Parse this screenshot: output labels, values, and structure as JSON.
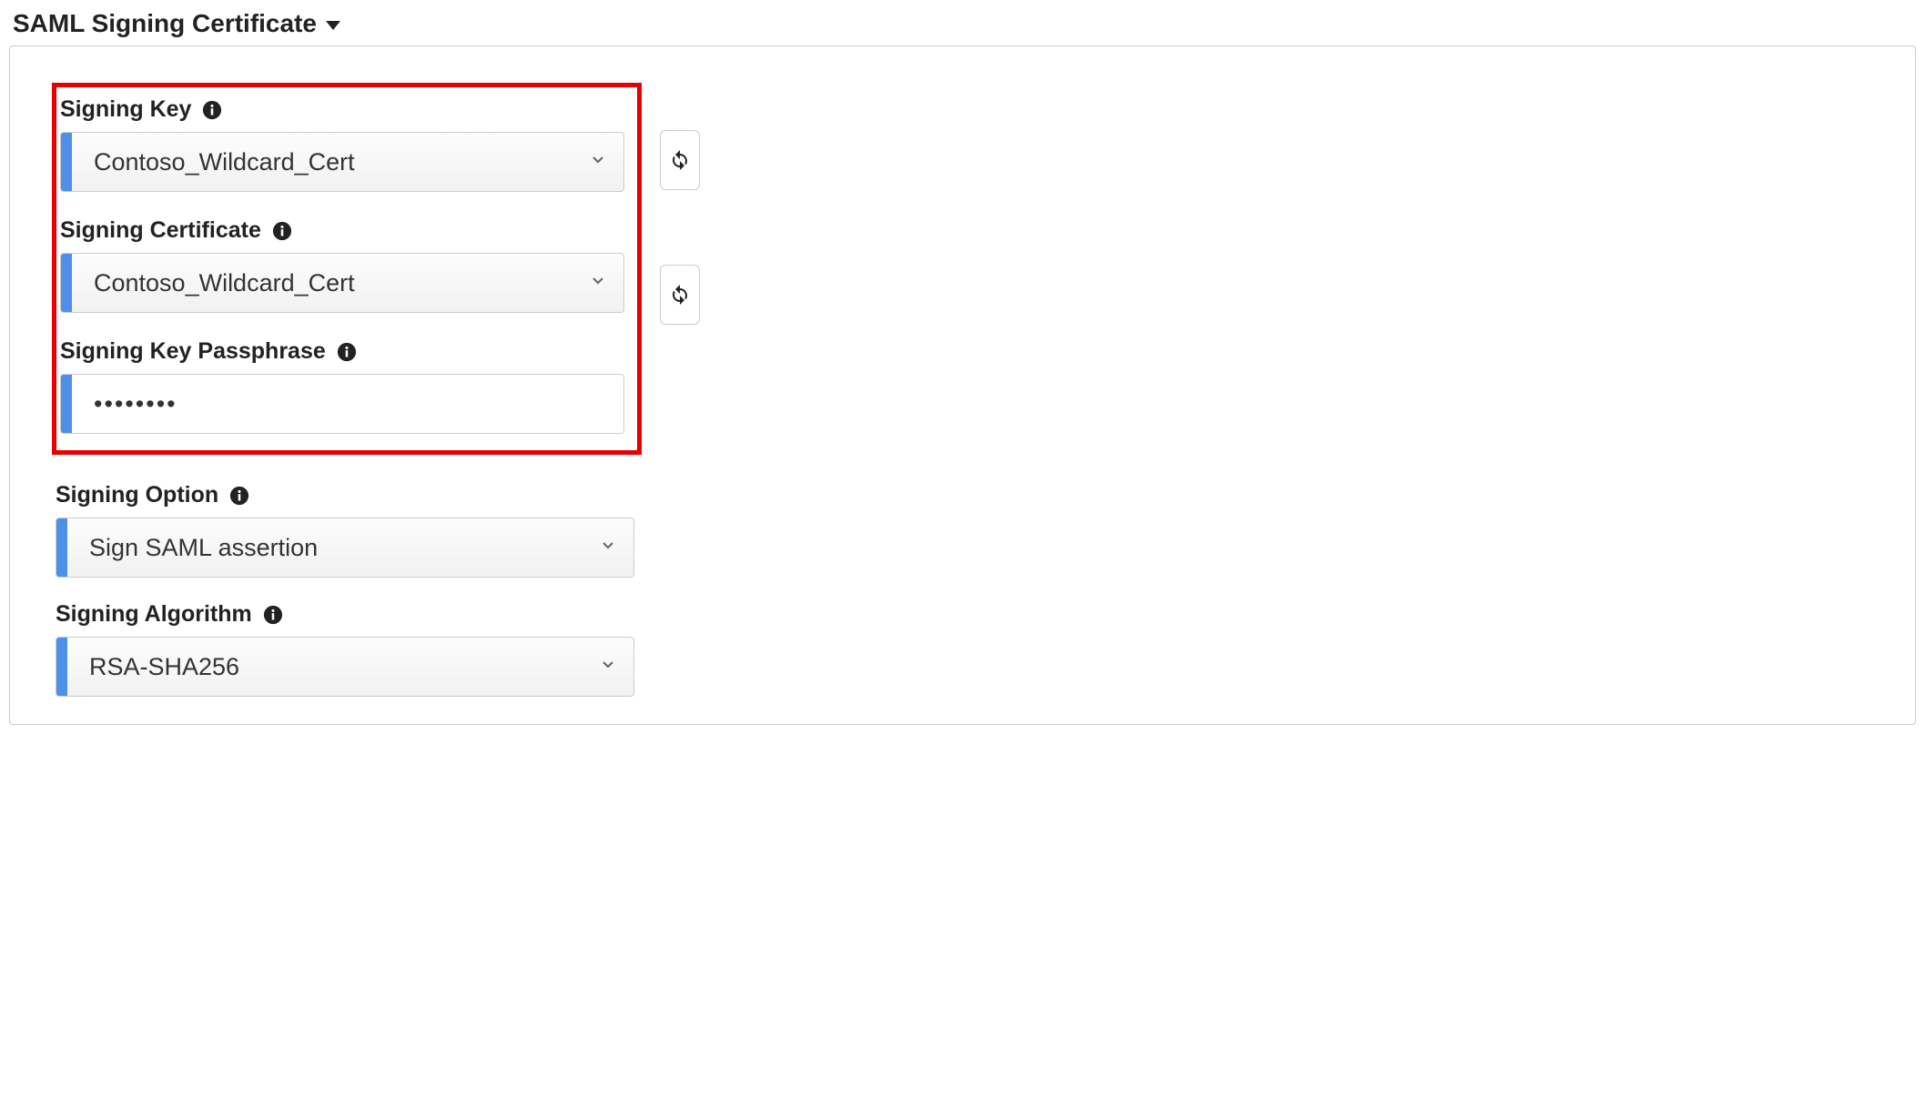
{
  "section": {
    "title": "SAML Signing Certificate"
  },
  "fields": {
    "signing_key": {
      "label": "Signing Key",
      "value": "Contoso_Wildcard_Cert"
    },
    "signing_certificate": {
      "label": "Signing Certificate",
      "value": "Contoso_Wildcard_Cert"
    },
    "signing_key_passphrase": {
      "label": "Signing Key Passphrase",
      "value": "••••••••"
    },
    "signing_option": {
      "label": "Signing Option",
      "value": "Sign SAML assertion"
    },
    "signing_algorithm": {
      "label": "Signing Algorithm",
      "value": "RSA-SHA256"
    }
  }
}
